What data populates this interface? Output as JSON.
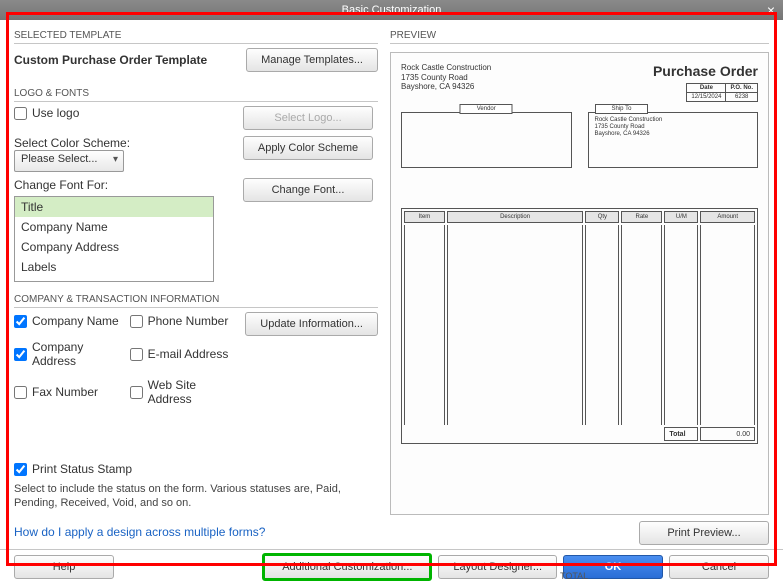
{
  "window": {
    "title": "Basic Customization"
  },
  "selected_template": {
    "section": "SELECTED TEMPLATE",
    "name": "Custom Purchase Order Template",
    "manage_btn": "Manage Templates..."
  },
  "logo_fonts": {
    "section": "LOGO & FONTS",
    "use_logo_label": "Use logo",
    "use_logo_checked": false,
    "select_logo_btn": "Select Logo...",
    "color_scheme_label": "Select Color Scheme:",
    "color_scheme_value": "Please Select...",
    "apply_color_btn": "Apply Color Scheme",
    "change_font_label": "Change Font For:",
    "change_font_btn": "Change Font...",
    "font_items": [
      "Title",
      "Company Name",
      "Company Address",
      "Labels"
    ],
    "font_selected": "Title"
  },
  "company_info": {
    "section": "COMPANY & TRANSACTION INFORMATION",
    "update_btn": "Update Information...",
    "items": [
      {
        "label": "Company Name",
        "checked": true
      },
      {
        "label": "Phone Number",
        "checked": false
      },
      {
        "label": "Company Address",
        "checked": true
      },
      {
        "label": "E-mail Address",
        "checked": false
      },
      {
        "label": "Fax Number",
        "checked": false
      },
      {
        "label": "Web Site Address",
        "checked": false
      }
    ],
    "print_status_label": "Print Status Stamp",
    "print_status_checked": true,
    "print_status_desc": "Select to include the status on the form. Various statuses are, Paid, Pending, Received, Void, and so on."
  },
  "help_link": "How do I apply a design across multiple forms?",
  "preview": {
    "section": "PREVIEW",
    "company_name": "Rock Castle Construction",
    "company_addr1": "1735 County Road",
    "company_addr2": "Bayshore, CA 94326",
    "doc_title": "Purchase Order",
    "meta_headers": [
      "Date",
      "P.O. No."
    ],
    "meta_values": [
      "12/15/2024",
      "6238"
    ],
    "vendor_header": "Vendor",
    "shipto_header": "Ship To",
    "shipto_name": "Rock Castle Construction",
    "shipto_addr1": "1735 County Road",
    "shipto_addr2": "Bayshore, CA 94326",
    "item_headers": [
      "Item",
      "Description",
      "Qty",
      "Rate",
      "U/M",
      "Amount"
    ],
    "total_label": "Total",
    "total_value": "0.00",
    "print_preview_btn": "Print Preview..."
  },
  "buttons": {
    "help": "Help",
    "additional": "Additional Customization...",
    "layout": "Layout Designer...",
    "ok": "OK",
    "cancel": "Cancel"
  },
  "footer": {
    "total": "TOTAL"
  }
}
